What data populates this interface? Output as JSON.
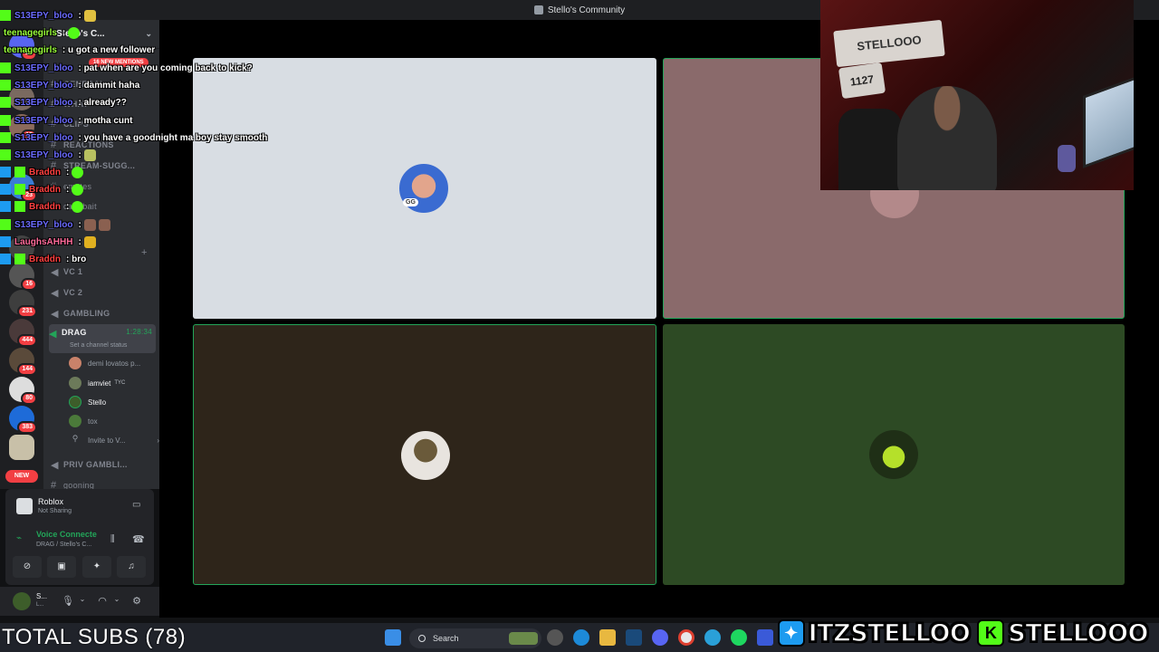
{
  "window": {
    "title": "Stello's Community"
  },
  "server": {
    "name": "Stello's C...",
    "mentions_pill": "16 NEW MENTIONS"
  },
  "rail": {
    "badges": [
      "48",
      "15",
      "23",
      "16",
      "231",
      "444",
      "144",
      "80",
      "383"
    ],
    "new_label": "NEW"
  },
  "channels": {
    "text": [
      "GENERAL",
      "CLIPS",
      "REACTIONS",
      "STREAM-SUGG...",
      "emotes",
      "cam-bait"
    ],
    "voice": [
      "VC 1",
      "VC 2",
      "GAMBLING"
    ],
    "active": {
      "name": "DRAG",
      "time": "1:28:34",
      "status": "Set a channel status"
    },
    "members": [
      {
        "name": "demi lovatos p..."
      },
      {
        "name": "iamviet",
        "tag": "TYC"
      },
      {
        "name": "Stello"
      },
      {
        "name": "tox"
      }
    ],
    "invite": "Invite to V...",
    "after": [
      "PRIV GAMBLI...",
      "gooning"
    ]
  },
  "activity": {
    "title": "Roblox",
    "sub": "Not Sharing"
  },
  "voice": {
    "title": "Voice Connecte",
    "sub": "DRAG / Stello's C..."
  },
  "userbar": {
    "name": "S...",
    "sub": "L..."
  },
  "chat": [
    {
      "user": "S13EPY_bloo",
      "text": ":",
      "color": "#6b6bff"
    },
    {
      "user": "teenagegirls",
      "text": ":",
      "color": "#9aff3a"
    },
    {
      "user": "teenagegirls",
      "text": ": u got a new follower",
      "color": "#9aff3a"
    },
    {
      "user": "S13EPY_bloo",
      "text": ": pat when are you coming back to kick?",
      "color": "#6b6bff"
    },
    {
      "user": "S13EPY_bloo",
      "text": ": dammit haha",
      "color": "#6b6bff"
    },
    {
      "user": "S13EPY_bloo",
      "text": ": already??",
      "color": "#6b6bff"
    },
    {
      "user": "S13EPY_bloo",
      "text": ": motha cunt",
      "color": "#6b6bff"
    },
    {
      "user": "S13EPY_bloo",
      "text": ": you have a goodnight ma boy stay smooth",
      "color": "#6b6bff"
    },
    {
      "user": "S13EPY_bloo",
      "text": ":",
      "color": "#6b6bff"
    },
    {
      "user": "Braddn",
      "text": ":",
      "color": "#ff4040"
    },
    {
      "user": "Braddn",
      "text": ":",
      "color": "#ff4040"
    },
    {
      "user": "Braddn",
      "text": ":",
      "color": "#ff4040"
    },
    {
      "user": "S13EPY_bloo",
      "text": ":",
      "color": "#6b6bff"
    },
    {
      "user": "LaughsAHHH",
      "text": ":",
      "color": "#ff6b9a"
    },
    {
      "user": "Braddn",
      "text": ": bro",
      "color": "#ff4040"
    }
  ],
  "chat_overlap": {
    "whatttt": "WHAT"
  },
  "stream": {
    "tiles": [
      {
        "name": "tile-top-left",
        "bg": "#d8dde3"
      },
      {
        "name": "tile-top-right",
        "bg": "#8a6a6b"
      },
      {
        "name": "tile-bottom-left",
        "bg": "#2e251a"
      },
      {
        "name": "tile-bottom-right",
        "bg": "#2d4a24"
      }
    ],
    "avatar_badge": "GG"
  },
  "webcam": {
    "sign_text": "STELLOOO",
    "sign2_text": "1127"
  },
  "overlay": {
    "total_subs": "TOTAL SUBS (78)"
  },
  "taskbar": {
    "search_placeholder": "Search"
  },
  "socials": {
    "twitter": "ITZSTELLOO",
    "kick_letter": "K",
    "kick": "STELLOOO"
  },
  "colors": {
    "discord_green": "#23a559",
    "kick_green": "#53fc18",
    "twitter_blue": "#1d9bf0"
  }
}
